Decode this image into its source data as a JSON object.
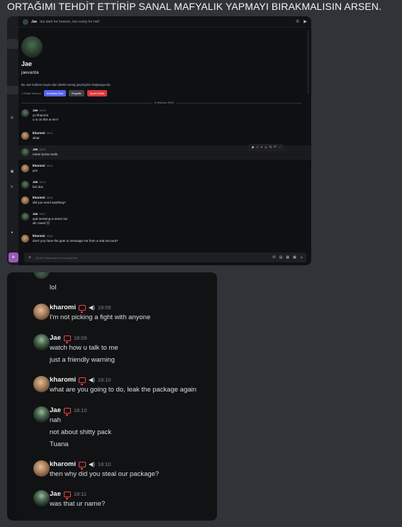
{
  "caption": "ORTAĞIMI TEHDİT ETTİRİP SANAL MAFYALIK YAPMAYI BIRAKMALISIN ARSEN.",
  "top_window": {
    "header": {
      "name": "Jae",
      "status": "too dark for heaven, too cocky for hell"
    },
    "profile": {
      "display_name": "Jae",
      "username": "jaevanta",
      "intro": "Bu Jae kullanıcısıyla olan direkt mesaj geçmişinin başlangıcıdır.",
      "mutual": "1 Ortak Sunucu",
      "buttons": {
        "friend": "Arkadaş Ekle",
        "block": "Engelle",
        "spam": "Spam Bildir"
      }
    },
    "date_divider": "5 Haziran 2024",
    "messages": [
      {
        "user": "Jae",
        "time": "18:03",
        "lines": [
          "yo kharomi",
          "u in on this w em?"
        ]
      },
      {
        "user": "kharomi",
        "time": "18:03",
        "lines": [
          "what"
        ]
      },
      {
        "user": "Jae",
        "time": "18:03",
        "lines": [
          "mean lyvria mods"
        ]
      },
      {
        "user": "kharomi",
        "time": "18:03",
        "lines": [
          "yes"
        ]
      },
      {
        "user": "Jae",
        "time": "18:04",
        "lines": [
          "fair dos"
        ]
      },
      {
        "user": "kharomi",
        "time": "18:06",
        "lines": [
          "did you need anything?"
        ]
      },
      {
        "user": "Jae",
        "time": "18:07",
        "lines": [
          "quit messing w arsen luv",
          "all i need 😊"
        ]
      },
      {
        "user": "kharomi",
        "time": "18:08",
        "lines": [
          "don't you have the guts to message me from a real account?"
        ]
      }
    ],
    "input_placeholder": "@Jae kullanıcısına mesaj gönder"
  },
  "bottom_window": {
    "lead_line": "lol",
    "messages": [
      {
        "user": "kharomi",
        "time": "18:09",
        "lines": [
          "I'm not picking a fight with anyone"
        ]
      },
      {
        "user": "Jae",
        "time": "18:09",
        "lines": [
          "watch how u talk to me",
          "just a friendly warning"
        ]
      },
      {
        "user": "kharomi",
        "time": "18:10",
        "lines": [
          "what are you going to do, leak the package again"
        ]
      },
      {
        "user": "Jae",
        "time": "18:10",
        "lines": [
          "nah",
          "not about shitty pack",
          "Tuana"
        ]
      },
      {
        "user": "kharomi",
        "time": "18:10",
        "lines": [
          "then why did you steal our package?"
        ]
      },
      {
        "user": "Jae",
        "time": "18:11",
        "lines": [
          "was that ur name?"
        ]
      }
    ]
  },
  "colors": {
    "accent_blue": "#5865f2",
    "danger_red": "#da373c",
    "bg_dark": "#0f1013",
    "bg_page": "#313338"
  }
}
